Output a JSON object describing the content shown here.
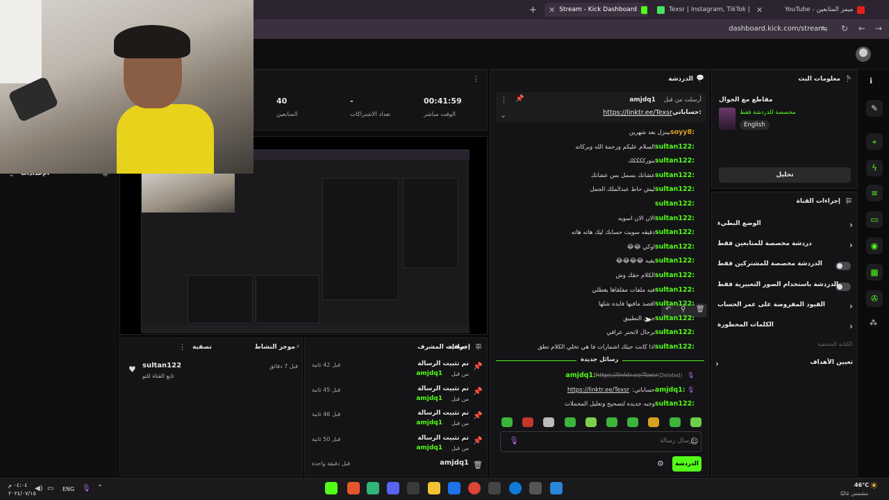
{
  "browser": {
    "tabs": [
      {
        "title": "Stream - Kick Dashboard",
        "active": true
      },
      {
        "title": "Texsr | Instagram, TikTok | Linktr",
        "active": false
      },
      {
        "title": "YouTube - ميمز المتابعين",
        "active": false
      }
    ],
    "url": "dashboard.kick.com/stream",
    "new_tab": "+"
  },
  "stats": {
    "live_time_value": "00:41:59",
    "live_time_label": "الوقت مباشر",
    "subs_value": "-",
    "subs_label": "تعداد الاشتراكات",
    "viewers_value": "40",
    "viewers_label": "المتابعين"
  },
  "settings_label": "الإعدادات",
  "chat": {
    "title": "الدردشة",
    "pinned": {
      "sent_by": "أرسلت من قبل",
      "user": "amjdq1",
      "prefix": "حساباتي:",
      "link": "https://linktr.ee/Texsr"
    },
    "messages": [
      {
        "user": "soyy8",
        "text": "بينزل بعد شهرين",
        "orange": true
      },
      {
        "user": "sultan122",
        "text": "السلام عليكم ورحمة الله وبركاته"
      },
      {
        "user": "sultan122",
        "text": "بنورككككك"
      },
      {
        "user": "sultan122",
        "text": "عشانك بسمل بس عشانك"
      },
      {
        "user": "sultan122",
        "text": "ليش حاط عبدالملك الجمل"
      },
      {
        "user": "sultan122",
        "text": ""
      },
      {
        "user": "sultan122",
        "text": "الان الان اسويه"
      },
      {
        "user": "sultan122",
        "text": "دقيقه سويت حسابك ليك هاته هاته"
      },
      {
        "user": "sultan122",
        "text": "اوكي 😂😂"
      },
      {
        "user": "sultan122",
        "text": "يقيه 😂😂😂😂"
      },
      {
        "user": "sultan122",
        "text": "الكلام حقك وش"
      },
      {
        "user": "sultan122",
        "text": "فيه ملفات مفلقاها يغطلي"
      },
      {
        "user": "sultan122",
        "text": "اقصد مافيها فايده شلها"
      },
      {
        "user": "sultan122",
        "text": "جوي التطبيق"
      },
      {
        "user": "sultan122",
        "text": "برجال لاتحتر عرافي"
      },
      {
        "user": "sultan122",
        "text": "اذا كانت جيئك اشمارات فا هي تخلي الكلام تطق"
      }
    ],
    "new_messages_label": "رسائل جديدة",
    "new_messages": [
      {
        "user": "amjdq1",
        "text": "https://linktr.ee/Texsr",
        "note": "(Deleted)",
        "deleted": true
      },
      {
        "user": "amjdq1",
        "text": "حساباتي:",
        "link": "https://linktr.ee/Texsr"
      },
      {
        "user": "sultan122",
        "text": "وجبه جديده لتصحيح وتعليل المحملات"
      }
    ],
    "input_placeholder": "إرسال رسالة",
    "send_button": "الدردشة"
  },
  "stream_info": {
    "title": "معلومات البث",
    "category_heading": "مقاطع مع الجوال",
    "category_sub": "مخصصة للدردشة فقط",
    "language_badge": "English",
    "edit_button": "تحليل"
  },
  "channel_actions": {
    "title": "إجراءات القناة",
    "items": [
      {
        "label": "الوضع البطيء",
        "control": "chevron"
      },
      {
        "label": "دردشة مخصصة للمتابعين فقط",
        "control": "chevron"
      },
      {
        "label": "الدردشة مخصصة للمشتركين فقط",
        "control": "switch"
      },
      {
        "label": "الدردشة باستخدام الصور التعبيرية فقط",
        "control": "switch"
      },
      {
        "label": "القيود المفروضة على عمر الحساب",
        "control": "chevron"
      },
      {
        "label": "الكلمات المحظورة",
        "control": "chevron"
      }
    ],
    "note": "الكتابة المتخفية",
    "goals": "تعيين الأهداف"
  },
  "mod_actions": {
    "title": "إجراءات المشرف",
    "filter": "تصفية",
    "items": [
      {
        "action": "تم تثبيت الرسالة",
        "by": "من قبل",
        "user": "amjdq1",
        "time": "قبل 42 ثانية"
      },
      {
        "action": "تم تثبيت الرسالة",
        "by": "من قبل",
        "user": "amjdq1",
        "time": "قبل 45 ثانية"
      },
      {
        "action": "تم تثبيت الرسالة",
        "by": "من قبل",
        "user": "amjdq1",
        "time": "قبل 46 ثانية"
      },
      {
        "action": "تم تثبيت الرسالة",
        "by": "من قبل",
        "user": "amjdq1",
        "time": "قبل 50 ثانية"
      },
      {
        "action": "",
        "by": "",
        "user": "amjdq1",
        "time": "قبل دقيقة واحدة"
      }
    ]
  },
  "activity": {
    "title": "موجز النشاط",
    "filter": "تصفية",
    "item": {
      "user": "sultan122",
      "text": "تابع القناة للتو",
      "time": "قبل 7 دقائق"
    }
  },
  "taskbar": {
    "weather": "46°C",
    "weather_desc": "مشمس غالبًا",
    "lang": "ENG",
    "time": "٠٤:٠٤ م",
    "date": "٢٠٢٤/٠٧/١٥"
  }
}
